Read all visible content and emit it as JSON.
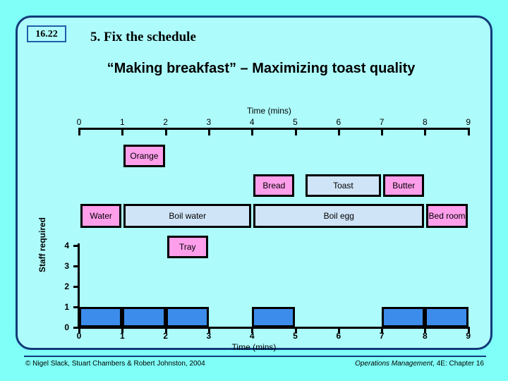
{
  "slide": {
    "number": "16.22",
    "heading": "5. Fix the schedule",
    "subtitle": "“Making breakfast” – Maximizing toast quality",
    "background_color": "#7FFFF7",
    "border_color": "#123A7A"
  },
  "gantt": {
    "axis_caption": "Time (mins)",
    "tick_labels": [
      "0",
      "1",
      "2",
      "3",
      "4",
      "5",
      "6",
      "7",
      "8",
      "9"
    ],
    "axis_min": 0,
    "axis_max": 9,
    "tasks": [
      {
        "label": "Orange",
        "start": 1,
        "end": 2,
        "row": 0,
        "color": "#FF9EEB",
        "kind": "pink"
      },
      {
        "label": "Bread",
        "start": 4,
        "end": 5,
        "row": 1,
        "color": "#FF9EEB",
        "kind": "pink"
      },
      {
        "label": "Toast",
        "start": 5.2,
        "end": 7,
        "row": 1,
        "color": "#CFE4F7",
        "kind": "blue"
      },
      {
        "label": "Butter",
        "start": 7,
        "end": 8,
        "row": 1,
        "color": "#FF9EEB",
        "kind": "pink"
      },
      {
        "label": "Water",
        "start": 0,
        "end": 1,
        "row": 2,
        "color": "#FF9EEB",
        "kind": "pink"
      },
      {
        "label": "Boil water",
        "start": 1,
        "end": 4,
        "row": 2,
        "color": "#CFE4F7",
        "kind": "blue"
      },
      {
        "label": "Boil egg",
        "start": 4,
        "end": 8,
        "row": 2,
        "color": "#CFE4F7",
        "kind": "blue"
      },
      {
        "label": "Bed room",
        "start": 8,
        "end": 9,
        "row": 2,
        "color": "#FF9EEB",
        "kind": "pink"
      },
      {
        "label": "Tray",
        "start": 2,
        "end": 3,
        "row": 3,
        "color": "#FF9EEB",
        "kind": "pink"
      }
    ]
  },
  "chart_data": {
    "type": "bar",
    "title": "",
    "xlabel": "Time (mins)",
    "ylabel": "Staff required",
    "x_tick_labels": [
      "0",
      "1",
      "2",
      "3",
      "4",
      "5",
      "6",
      "7",
      "8",
      "9"
    ],
    "y_tick_labels": [
      "0",
      "1",
      "2",
      "3",
      "4"
    ],
    "xlim": [
      0,
      9
    ],
    "ylim": [
      0,
      4
    ],
    "grid": false,
    "legend": "none",
    "bar_color": "#3C8CEB",
    "intervals": [
      {
        "start": 0,
        "end": 1,
        "value": 1
      },
      {
        "start": 1,
        "end": 2,
        "value": 1
      },
      {
        "start": 2,
        "end": 3,
        "value": 1
      },
      {
        "start": 3,
        "end": 4,
        "value": 0
      },
      {
        "start": 4,
        "end": 5,
        "value": 1
      },
      {
        "start": 5,
        "end": 7,
        "value": 0
      },
      {
        "start": 7,
        "end": 8,
        "value": 1
      },
      {
        "start": 8,
        "end": 9,
        "value": 1
      }
    ],
    "categories": [
      "0-1",
      "1-2",
      "2-3",
      "3-4",
      "4-5",
      "5-6",
      "6-7",
      "7-8",
      "8-9"
    ],
    "values": [
      1,
      1,
      1,
      0,
      1,
      0,
      0,
      1,
      1
    ]
  },
  "footer": {
    "left": "© Nigel Slack, Stuart Chambers & Robert Johnston, 2004",
    "right_italic": "Operations Management",
    "right_rest": ", 4E: Chapter 16"
  }
}
